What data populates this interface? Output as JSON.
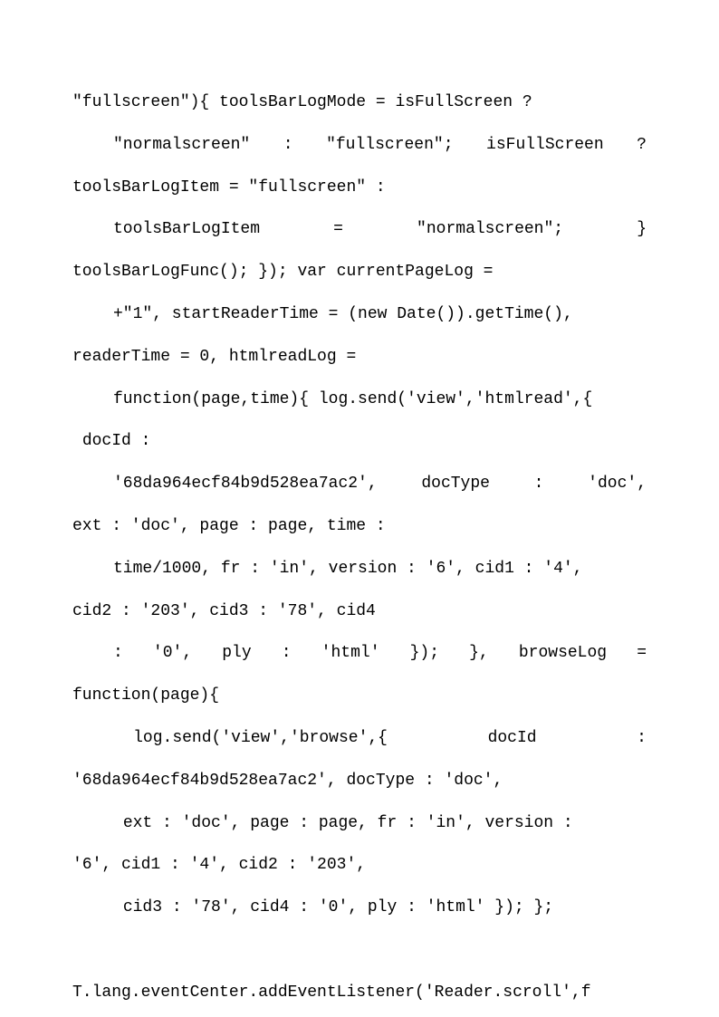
{
  "lines": [
    {
      "cls": "line",
      "text": "\"fullscreen\"){ toolsBarLogMode = isFullScreen ?"
    },
    {
      "cls": "line indent1 justify",
      "text": "\"normalscreen\" : \"fullscreen\"; isFullScreen ?"
    },
    {
      "cls": "line",
      "text": "toolsBarLogItem = \"fullscreen\" :"
    },
    {
      "cls": "line indent1 justify",
      "text": "toolsBarLogItem   =   \"normalscreen\";   }"
    },
    {
      "cls": "line",
      "text": "toolsBarLogFunc(); }); var currentPageLog ="
    },
    {
      "cls": "line indent1",
      "text": "+\"1\", startReaderTime = (new Date()).getTime(),"
    },
    {
      "cls": "line",
      "text": "readerTime = 0, htmlreadLog ="
    },
    {
      "cls": "line indent1",
      "text": "function(page,time){ log.send('view','htmlread',{"
    },
    {
      "cls": "line",
      "text": " docId :"
    },
    {
      "cls": "line indent1 justify",
      "text": "'68da964ecf84b9d528ea7ac2',  docType  :  'doc',"
    },
    {
      "cls": "line",
      "text": "ext : 'doc', page : page, time :"
    },
    {
      "cls": "line indent1",
      "text": "time/1000, fr : 'in', version : '6', cid1 : '4',"
    },
    {
      "cls": "line",
      "text": "cid2 : '203', cid3 : '78', cid4"
    },
    {
      "cls": "line indent1 justify",
      "text": ":  '0',  ply  :  'html'  });  },  browseLog  ="
    },
    {
      "cls": "line",
      "text": "function(page){"
    },
    {
      "cls": "line indent1 justify",
      "text": " log.send('view','browse',{     docId     :"
    },
    {
      "cls": "line",
      "text": "'68da964ecf84b9d528ea7ac2', docType : 'doc',"
    },
    {
      "cls": "line indent1",
      "text": " ext : 'doc', page : page, fr : 'in', version :"
    },
    {
      "cls": "line",
      "text": "'6', cid1 : '4', cid2 : '203',"
    },
    {
      "cls": "line indent1",
      "text": " cid3 : '78', cid4 : '0', ply : 'html' }); };"
    },
    {
      "cls": "line",
      "text": " "
    },
    {
      "cls": "line",
      "text": "T.lang.eventCenter.addEventListener('Reader.scroll',f"
    }
  ]
}
